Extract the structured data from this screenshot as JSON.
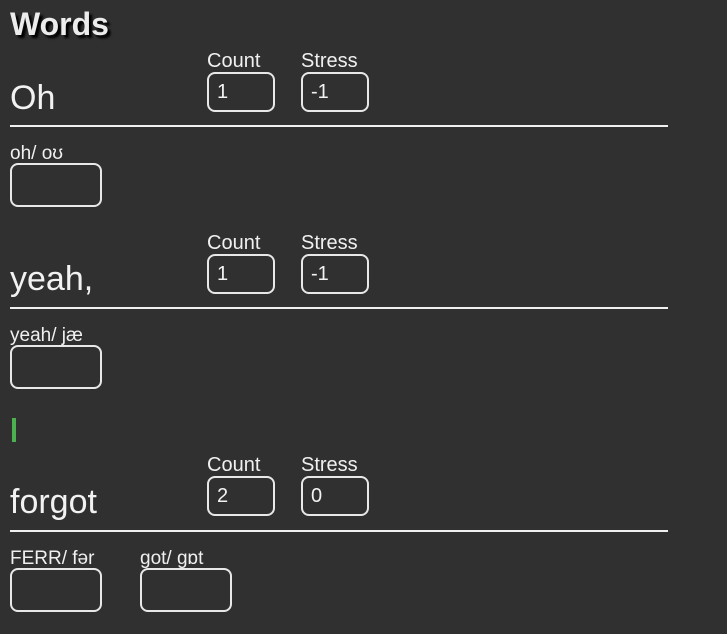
{
  "title": "Words",
  "labels": {
    "count": "Count",
    "stress": "Stress"
  },
  "words": [
    {
      "text": "Oh",
      "count": "1",
      "stress": "-1",
      "syllables": [
        {
          "label": "oh/ oʊ",
          "value": ""
        }
      ]
    },
    {
      "text": "yeah,",
      "count": "1",
      "stress": "-1",
      "syllables": [
        {
          "label": "yeah/ jæ",
          "value": ""
        }
      ]
    },
    {
      "text": "forgot",
      "count": "2",
      "stress": "0",
      "syllables": [
        {
          "label": "FERR/ fər",
          "value": ""
        },
        {
          "label": "got/ gɒt",
          "value": ""
        }
      ]
    }
  ],
  "colors": {
    "background": "#303030",
    "text": "#ececec",
    "accent_mark": "#4caf50"
  }
}
